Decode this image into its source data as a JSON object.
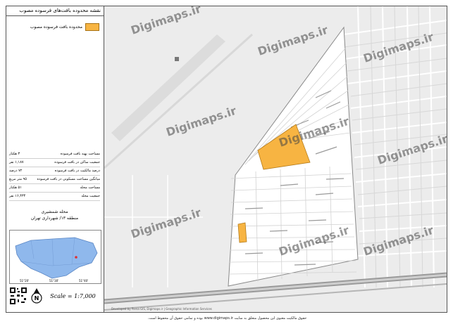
{
  "map": {
    "title": "نقشه محدوده بافت‌های فرسوده مصوب",
    "legend_label": "محدوده بافت فرسوده مصوب",
    "legend_color": "#f7b442",
    "stats": [
      {
        "label": "مساحت پهنه بافت فرسوده",
        "value": "۳ هکتار"
      },
      {
        "label": "جمعیت ساکن در بافت فرسوده",
        "value": "۱,۱۸۷ نفر"
      },
      {
        "label": "درصد مالکیت در بافت فرسوده",
        "value": "۷۲ درصد"
      },
      {
        "label": "میانگین مساحت مسکونی در بافت فرسوده",
        "value": "۹۵ متر مربع"
      },
      {
        "label": "مساحت محله",
        "value": "۵۱ هکتار"
      },
      {
        "label": "جمعیت محله",
        "value": "۱۶,۴۳۴ نفر"
      }
    ],
    "neighborhood": "محله شمشیری",
    "district": "منطقه ۱۳/ شهرداری تهران",
    "scale": "Scale = 1:7,000",
    "inset_ticks": [
      "51°20'",
      "51°30'",
      "51°40'"
    ],
    "footer": "حقوق مالکیت معنوی این محصول متعلق به سایت www.digimaps.ir بوده و تمامی حقوق آن محفوظ است.",
    "watermark": "Digimaps.ir",
    "brand_small": "Developed by Parsa GIS, Digimaps.ir | Geographic Information Services"
  }
}
